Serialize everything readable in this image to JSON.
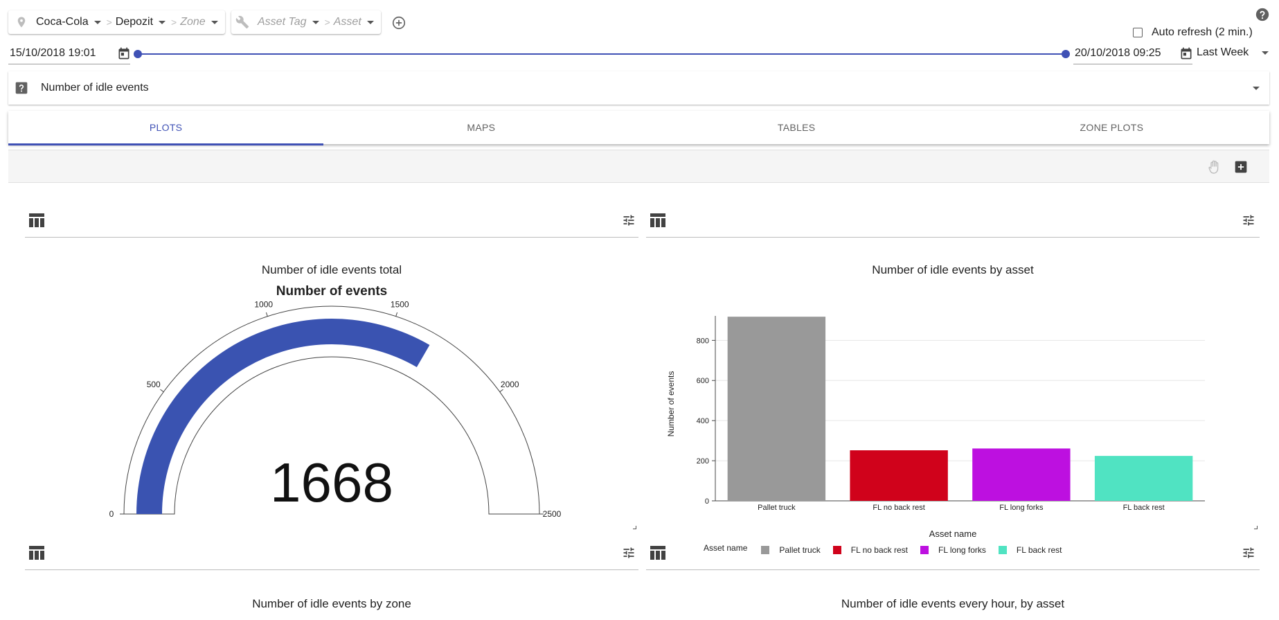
{
  "filters": {
    "client": "Coca-Cola",
    "site": "Depozit",
    "zone_placeholder": "Zone",
    "asset_tag_placeholder": "Asset Tag",
    "asset_placeholder": "Asset",
    "separator": ">"
  },
  "auto_refresh": {
    "label": "Auto refresh (2 min.)",
    "checked": false
  },
  "date_range": {
    "start": "15/10/2018 19:01",
    "end": "20/10/2018 09:25",
    "preset": "Last Week",
    "start_fraction": 0.0,
    "end_fraction": 1.0
  },
  "metric": {
    "label": "Number of idle events"
  },
  "tabs": [
    {
      "label": "PLOTS",
      "active": true
    },
    {
      "label": "MAPS",
      "active": false
    },
    {
      "label": "TABLES",
      "active": false
    },
    {
      "label": "ZONE PLOTS",
      "active": false
    }
  ],
  "colors": {
    "accent": "#3f51b5",
    "gauge_fill": "#3a53b1",
    "grid": "#e6e6e6"
  },
  "icons": {
    "location": "location-pin-icon",
    "wrench": "wrench-icon",
    "add": "add-circle-icon",
    "help": "help-circle-icon",
    "calendar": "calendar-icon",
    "hand": "hand-pan-icon",
    "add_box": "add-box-icon",
    "table": "table-icon",
    "tune": "tune-icon"
  },
  "panels": [
    {
      "title": "Number of idle events total",
      "chart_data": {
        "type": "gauge",
        "title": "Number of idle events total",
        "subtitle": "Number of events",
        "value": 1668,
        "value_label": "1668",
        "min": 0,
        "max": 2500,
        "ticks": [
          "0",
          "500",
          "1000",
          "1500",
          "2000",
          "2500"
        ]
      }
    },
    {
      "title": "Number of idle events by asset",
      "chart_data": {
        "type": "bar",
        "title": "Number of idle events by asset",
        "xlabel": "Asset name",
        "ylabel": "Number of events",
        "categories": [
          "Pallet truck",
          "FL no back rest",
          "FL long forks",
          "FL back rest"
        ],
        "values": [
          918,
          252,
          261,
          224
        ],
        "colors": [
          "#999999",
          "#d0021b",
          "#bd10e0",
          "#50e3c2"
        ],
        "ylim": [
          0,
          920
        ],
        "yticks": [
          "0",
          "200",
          "400",
          "600",
          "800"
        ],
        "legend_title": "Asset name",
        "legend_position": "bottom",
        "grid": true
      }
    },
    {
      "title": "Number of idle events by zone"
    },
    {
      "title": "Number of idle events every hour, by asset"
    }
  ]
}
